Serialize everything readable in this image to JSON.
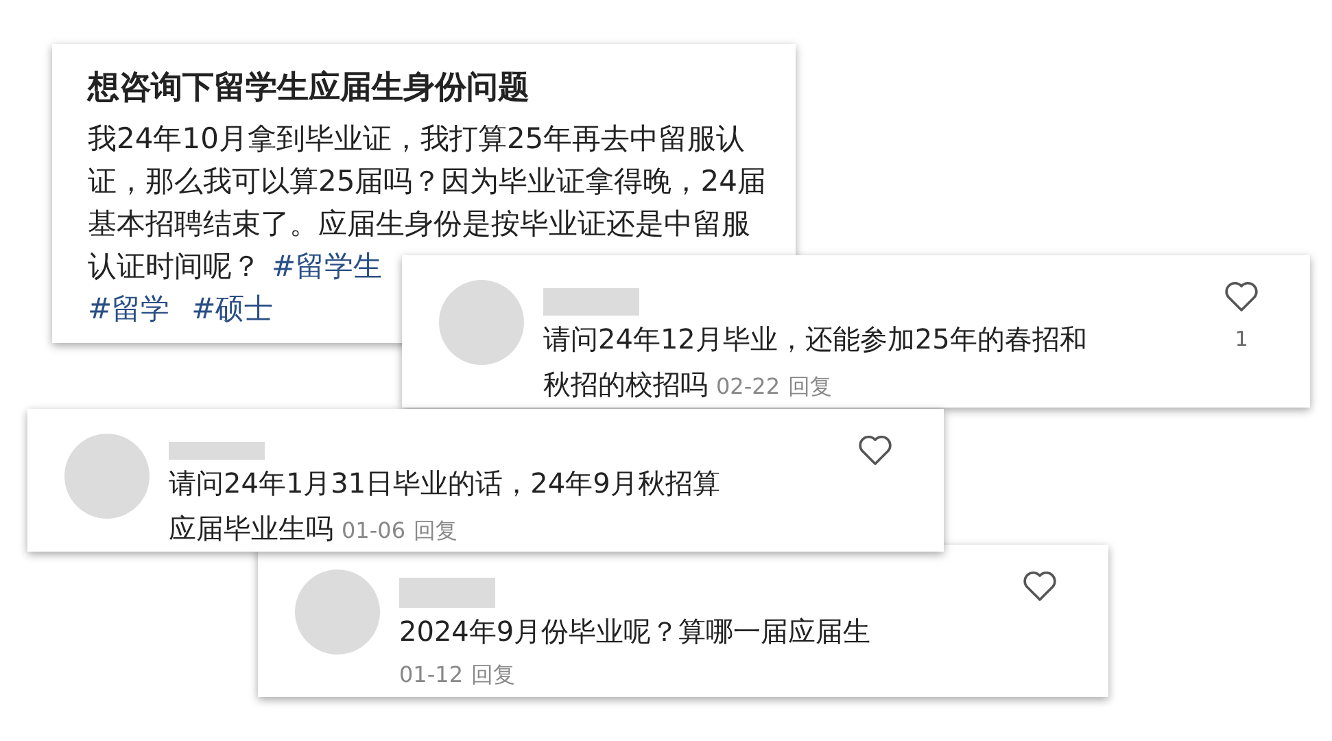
{
  "post": {
    "title": "想咨询下留学生应届生身份问题",
    "body": "我24年10月拿到毕业证，我打算25年再去中留服认证，那么我可以算25届吗？因为毕业证拿得晚，24届基本招聘结束了。应届生身份是按毕业证还是中留服认证时间呢？",
    "tags": [
      "#留学生",
      "#留学",
      "#硕士"
    ]
  },
  "comments": [
    {
      "text_lines": [
        "请问24年12月毕业，还能参加25年的春招和",
        "秋招的校招吗"
      ],
      "date": "02-22",
      "reply": "回复",
      "likes": "1",
      "meta_below": false
    },
    {
      "text_lines": [
        "请问24年1月31日毕业的话，24年9月秋招算",
        "应届毕业生吗"
      ],
      "date": "01-06",
      "reply": "回复",
      "meta_below": false
    },
    {
      "text_lines": [
        "2024年9月份毕业呢？算哪一届应届生"
      ],
      "date": "01-12",
      "reply": "回复",
      "meta_below": true
    }
  ]
}
